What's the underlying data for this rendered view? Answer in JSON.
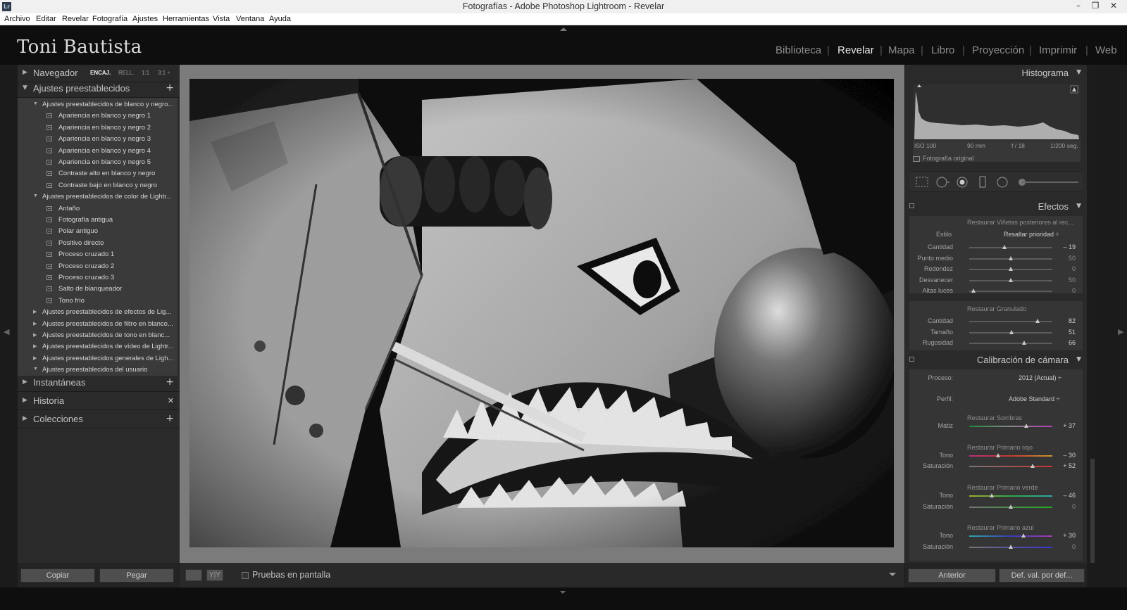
{
  "window": {
    "title": "Fotografías - Adobe Photoshop Lightroom - Revelar",
    "app_icon": "Lr"
  },
  "menu": [
    "Archivo",
    "Editar",
    "Revelar",
    "Fotografía",
    "Ajustes",
    "Herramientas",
    "Vista",
    "Ventana",
    "Ayuda"
  ],
  "identity": "Toni Bautista",
  "modules": [
    "Biblioteca",
    "Revelar",
    "Mapa",
    "Libro",
    "Proyección",
    "Imprimir",
    "Web"
  ],
  "active_module": "Revelar",
  "left": {
    "navigator": {
      "label": "Navegador",
      "options": [
        "ENCAJ.",
        "RELL.",
        "1:1",
        "3:1 ÷"
      ]
    },
    "presets_label": "Ajustes preestablecidos",
    "presets": [
      {
        "type": "folder",
        "open": true,
        "label": "Ajustes preestablecidos de blanco y negro..."
      },
      {
        "type": "item",
        "label": "Apariencia en blanco y negro 1"
      },
      {
        "type": "item",
        "label": "Apariencia en blanco y negro 2"
      },
      {
        "type": "item",
        "label": "Apariencia en blanco y negro 3"
      },
      {
        "type": "item",
        "label": "Apariencia en blanco y negro 4"
      },
      {
        "type": "item",
        "label": "Apariencia en blanco y negro 5"
      },
      {
        "type": "item",
        "label": "Contraste alto en blanco y negro"
      },
      {
        "type": "item",
        "label": "Contraste bajo en blanco y negro"
      },
      {
        "type": "folder",
        "open": true,
        "label": "Ajustes preestablecidos de color de Lightr..."
      },
      {
        "type": "item",
        "label": "Antaño"
      },
      {
        "type": "item",
        "label": "Fotografía antigua"
      },
      {
        "type": "item",
        "label": "Polar antiguo"
      },
      {
        "type": "item",
        "label": "Positivo directo"
      },
      {
        "type": "item",
        "label": "Proceso cruzado 1"
      },
      {
        "type": "item",
        "label": "Proceso cruzado 2"
      },
      {
        "type": "item",
        "label": "Proceso cruzado 3"
      },
      {
        "type": "item",
        "label": "Salto de blanqueador"
      },
      {
        "type": "item",
        "label": "Tono frío"
      },
      {
        "type": "folder",
        "open": false,
        "label": "Ajustes preestablecidos de efectos de Lig..."
      },
      {
        "type": "folder",
        "open": false,
        "label": "Ajustes preestablecidos de filtro en blanco..."
      },
      {
        "type": "folder",
        "open": false,
        "label": "Ajustes preestablecidos de tono en blanc..."
      },
      {
        "type": "folder",
        "open": false,
        "label": "Ajustes preestablecidos de vídeo de Lightr..."
      },
      {
        "type": "folder",
        "open": false,
        "label": "Ajustes preestablecidos generales de Ligh..."
      },
      {
        "type": "folder",
        "open": true,
        "label": "Ajustes preestablecidos del usuario"
      }
    ],
    "snapshots_label": "Instantáneas",
    "history_label": "Historia",
    "collections_label": "Colecciones",
    "copy_label": "Copiar",
    "paste_label": "Pegar"
  },
  "toolbar": {
    "view_grid_label": "Y|Y",
    "proof_label": "Pruebas en pantalla"
  },
  "right": {
    "histogram_label": "Histograma",
    "meta": {
      "iso": "ISO 100",
      "focal": "90 mm",
      "aperture": "f / 18",
      "shutter": "1/200 seg."
    },
    "original_label": "Fotografía original",
    "effects_label": "Efectos",
    "vignette": {
      "title": "Restaurar Viñetas posteriores al rec...",
      "style_label": "Estilo",
      "style_value": "Resaltar prioridad ÷",
      "sliders": [
        {
          "label": "Cantidad",
          "value": "– 19",
          "pos": 0.42,
          "dim": false
        },
        {
          "label": "Punto medio",
          "value": "50",
          "pos": 0.5,
          "dim": true
        },
        {
          "label": "Redondez",
          "value": "0",
          "pos": 0.5,
          "dim": true
        },
        {
          "label": "Desvanecer",
          "value": "50",
          "pos": 0.5,
          "dim": true
        },
        {
          "label": "Altas luces",
          "value": "0",
          "pos": 0.05,
          "dim": true
        }
      ]
    },
    "grain": {
      "title": "Restaurar Granulado",
      "sliders": [
        {
          "label": "Cantidad",
          "value": "82",
          "pos": 0.82
        },
        {
          "label": "Tamaño",
          "value": "51",
          "pos": 0.51
        },
        {
          "label": "Rugosidad",
          "value": "66",
          "pos": 0.66
        }
      ]
    },
    "calibration_label": "Calibración de cámara",
    "process_label": "Proceso:",
    "process_value": "2012 (Actual) ÷",
    "profile_label": "Perfil:",
    "profile_value": "Adobe Standard ÷",
    "shadows": {
      "title": "Restaurar Sombras",
      "label": "Matiz",
      "value": "+ 37",
      "pos": 0.685
    },
    "red": {
      "title": "Restaurar Primario rojo",
      "tone_label": "Tono",
      "tone_value": "– 30",
      "tone_pos": 0.35,
      "sat_label": "Saturación",
      "sat_value": "+ 52",
      "sat_pos": 0.76
    },
    "green": {
      "title": "Restaurar Primario verde",
      "tone_label": "Tono",
      "tone_value": "– 46",
      "tone_pos": 0.27,
      "sat_label": "Saturación",
      "sat_value": "0",
      "sat_pos": 0.5
    },
    "blue": {
      "title": "Restaurar Primario azul",
      "tone_label": "Tono",
      "tone_value": "+ 30",
      "tone_pos": 0.65,
      "sat_label": "Saturación",
      "sat_value": "0",
      "sat_pos": 0.5
    },
    "previous_label": "Anterior",
    "defaults_label": "Def. val. por def..."
  }
}
